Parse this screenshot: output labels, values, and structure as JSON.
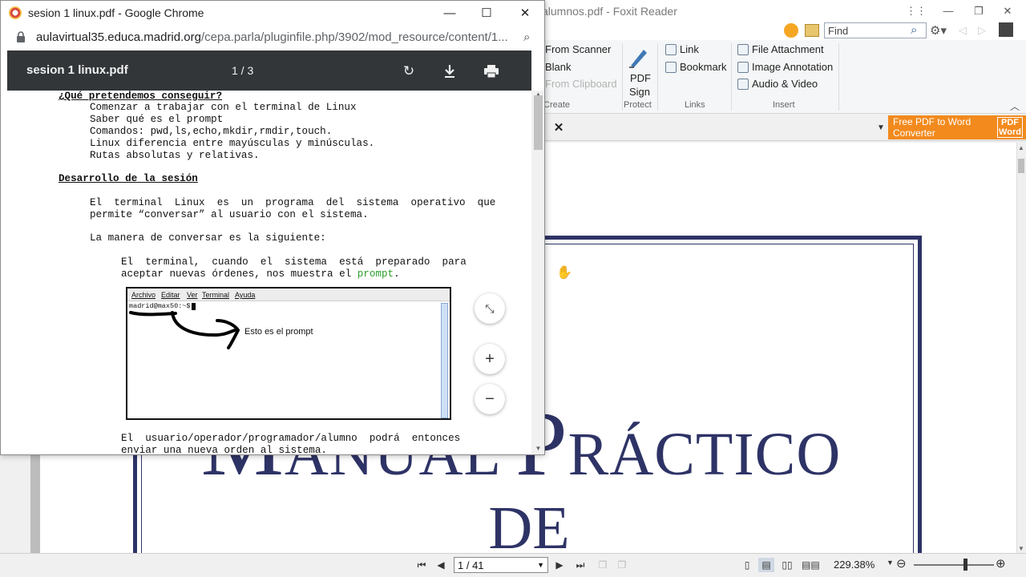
{
  "foxit": {
    "window_title": "alumnos.pdf - Foxit Reader",
    "find_placeholder": "Find",
    "ribbon": {
      "create": {
        "items": [
          "From Scanner",
          "Blank",
          "From Clipboard"
        ],
        "label": "Create"
      },
      "protect": {
        "sign_label_1": "PDF",
        "sign_label_2": "Sign",
        "label": "Protect"
      },
      "links": {
        "items": [
          "Link",
          "Bookmark"
        ],
        "label": "Links"
      },
      "insert": {
        "items": [
          "File Attachment",
          "Image Annotation",
          "Audio & Video"
        ],
        "label": "Insert"
      }
    },
    "promo": {
      "text_1": "Free PDF to Word",
      "text_2": "Converter",
      "badge_1": "PDF",
      "badge_2": "Word"
    },
    "document": {
      "title_part_1": "M",
      "title_part_2": "ANUAL ",
      "title_part_3": "P",
      "title_part_4": "RÁCTICO",
      "title_line_2": "DE"
    },
    "status": {
      "page_box": "1 / 41",
      "zoom": "229.38%"
    },
    "colors": {
      "title_navy": "#2e3366",
      "promo_orange": "#f28a1e"
    }
  },
  "chrome": {
    "window_title": "sesion 1 linux.pdf - Google Chrome",
    "url_host": "aulavirtual35.educa.madrid.org",
    "url_path": "/cepa.parla/pluginfile.php/3902/mod_resource/content/1...",
    "pdf_viewer": {
      "filename": "sesion 1 linux.pdf",
      "page_count": "1 / 3"
    },
    "pdf_content": {
      "heading_1": "¿Qué pretendemos conseguir?",
      "goals": [
        "Comenzar a trabajar con el terminal de Linux",
        "Saber qué es el prompt",
        "Comandos: pwd,ls,echo,mkdir,rmdir,touch.",
        "Linux diferencia entre mayúsculas y minúsculas.",
        "Rutas absolutas y relativas."
      ],
      "heading_2": "Desarrollo de la sesión",
      "para_1_line_1": "El  terminal  Linux  es  un  programa  del  sistema  operativo  que",
      "para_1_line_2": "permite “conversar” al usuario con el sistema.",
      "para_2": "La manera de conversar es la siguiente:",
      "para_3_line_1": "El  terminal,  cuando  el  sistema  está  preparado  para",
      "para_3_line_2_a": "aceptar nuevas órdenes, nos muestra el ",
      "para_3_line_2_b": "prompt",
      "para_3_line_2_c": ".",
      "terminal_menu": [
        "Archivo",
        "Editar",
        "Ver",
        "Terminal",
        "Ayuda"
      ],
      "terminal_prompt": "madrid@max50:~$",
      "terminal_annotation": "Esto es el prompt",
      "para_4_line_1": "El  usuario/operador/programador/alumno  podrá  entonces",
      "para_4_line_2": "enviar una nueva orden al sistema."
    },
    "colors": {
      "pdf_toolbar": "#323639",
      "prompt_green": "#2e9e2e"
    }
  }
}
